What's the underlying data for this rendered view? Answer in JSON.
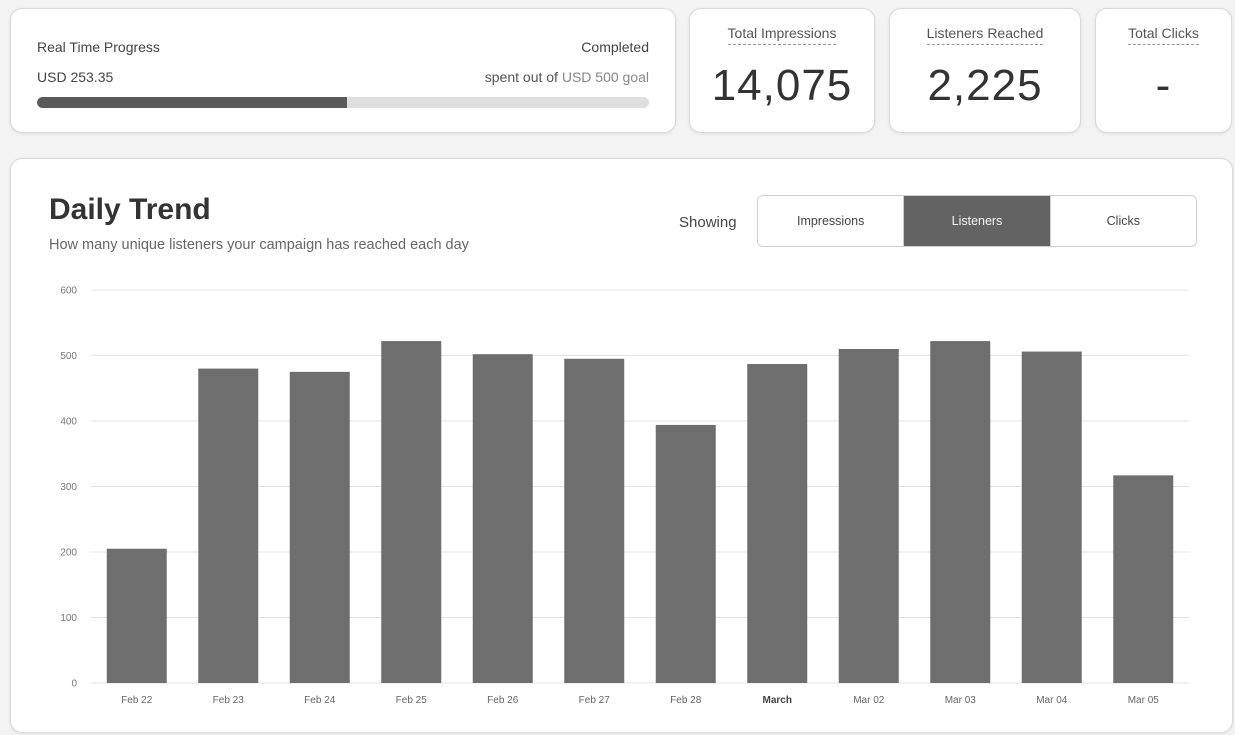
{
  "progress": {
    "title": "Real Time Progress",
    "status": "Completed",
    "spent": "USD 253.35",
    "goal_prefix": "spent out of ",
    "goal_amount": "USD 500 goal",
    "fraction": 0.5067
  },
  "stats": {
    "impressions": {
      "label": "Total Impressions",
      "value": "14,075"
    },
    "listeners": {
      "label": "Listeners Reached",
      "value": "2,225"
    },
    "clicks": {
      "label": "Total Clicks",
      "value": "-"
    }
  },
  "trend": {
    "title": "Daily Trend",
    "subtitle": "How many unique listeners your campaign has reached each day",
    "showing_label": "Showing",
    "tabs": [
      {
        "label": "Impressions",
        "active": false
      },
      {
        "label": "Listeners",
        "active": true
      },
      {
        "label": "Clicks",
        "active": false
      }
    ]
  },
  "colors": {
    "bar": "#6e6e6e",
    "grid": "#e4e4e4",
    "active_tab": "#636363",
    "progress_fill": "#5a5a5a"
  },
  "chart_data": {
    "type": "bar",
    "categories": [
      "Feb 22",
      "Feb 23",
      "Feb 24",
      "Feb 25",
      "Feb 26",
      "Feb 27",
      "Feb 28",
      "March",
      "Mar 02",
      "Mar 03",
      "Mar 04",
      "Mar 05"
    ],
    "bold_categories": [
      "March"
    ],
    "values": [
      205,
      480,
      475,
      522,
      502,
      495,
      394,
      487,
      510,
      522,
      506,
      317
    ],
    "yticks": [
      0,
      100,
      200,
      300,
      400,
      500,
      600
    ],
    "ylim": [
      0,
      600
    ],
    "grid": true,
    "legend": "none"
  }
}
